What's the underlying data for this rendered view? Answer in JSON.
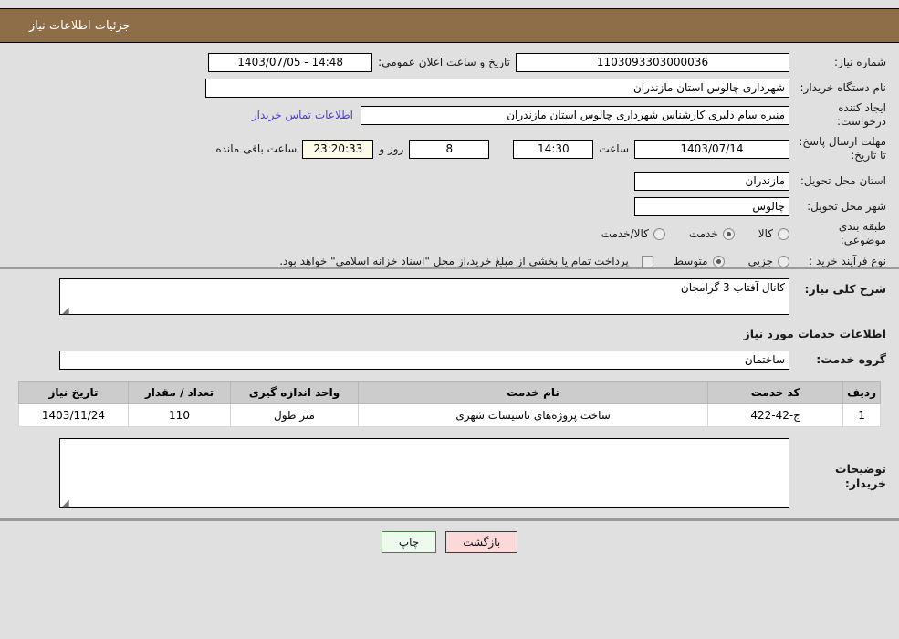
{
  "header": {
    "title": "جزئیات اطلاعات نیاز",
    "accent": "#8d6e49"
  },
  "form": {
    "need_number_label": "شماره نیاز:",
    "need_number_value": "1103093303000036",
    "public_announce_label": "تاریخ و ساعت اعلان عمومی:",
    "public_announce_value": "14:48 - 1403/07/05",
    "buyer_org_label": "نام دستگاه خریدار:",
    "buyer_org_value": "شهرداری چالوس استان مازندران",
    "creator_label": "ایجاد کننده درخواست:",
    "creator_value": "منیره سام دلیری کارشناس شهرداری چالوس استان مازندران",
    "contact_link": "اطلاعات تماس خریدار",
    "deadline_label": "مهلت ارسال پاسخ: تا تاریخ:",
    "deadline_date": "1403/07/14",
    "hour_label": "ساعت",
    "deadline_time": "14:30",
    "days_value": "8",
    "days_label": "روز و",
    "timer_value": "23:20:33",
    "timer_label": "ساعت باقی مانده",
    "province_label": "استان محل تحویل:",
    "province_value": "مازندران",
    "city_label": "شهر محل تحویل:",
    "city_value": "چالوس",
    "category_label": "طبقه بندی موضوعی:",
    "category_options": [
      {
        "label": "کالا",
        "selected": false
      },
      {
        "label": "خدمت",
        "selected": true
      },
      {
        "label": "کالا/خدمت",
        "selected": false
      }
    ],
    "process_label": "نوع فرآیند خرید :",
    "process_options": [
      {
        "label": "جزیی",
        "selected": false
      },
      {
        "label": "متوسط",
        "selected": true
      }
    ],
    "treasury_checkbox_checked": false,
    "treasury_note": "پرداخت تمام یا بخشی از مبلغ خرید،از محل \"اسناد خزانه اسلامی\" خواهد بود."
  },
  "details": {
    "summary_label": "شرح کلی نیاز:",
    "summary_value": "کانال آفتاب 3 گرامجان",
    "services_section_title": "اطلاعات خدمات مورد نیاز",
    "service_group_label": "گروه خدمت:",
    "service_group_value": "ساختمان",
    "buyer_notes_label": "توضیحات خریدار:",
    "buyer_notes_value": ""
  },
  "table": {
    "columns": [
      "ردیف",
      "کد خدمت",
      "نام خدمت",
      "واحد اندازه گیری",
      "تعداد / مقدار",
      "تاریخ نیاز"
    ],
    "rows": [
      {
        "index": "1",
        "code": "ج-42-422",
        "name": "ساخت پروژه‌های تاسیسات شهری",
        "unit": "متر طول",
        "quantity": "110",
        "need_date": "1403/11/24"
      }
    ]
  },
  "footer": {
    "print_label": "چاپ",
    "back_label": "بازگشت"
  }
}
